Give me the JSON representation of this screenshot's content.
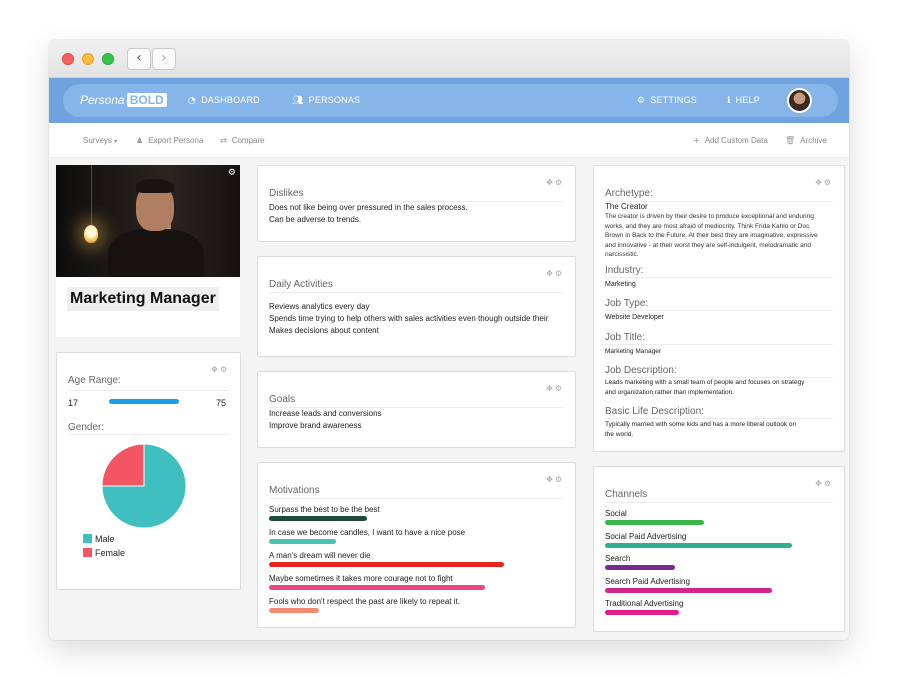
{
  "window": {
    "back_icon": "chevron-left-icon",
    "forward_icon": "chevron-right-icon"
  },
  "appbar": {
    "logo_text": "Persona",
    "logo_bold": "BOLD",
    "dashboard_label": "DASHBOARD",
    "personas_label": "PERSONAS",
    "settings_label": "SETTINGS",
    "help_label": "HELP"
  },
  "subbar": {
    "surveys_label": "Surveys",
    "export_label": "Export Persona",
    "compare_label": "Compare",
    "add_custom_label": "Add Custom Data",
    "archive_label": "Archive"
  },
  "profile": {
    "title": "Marketing Manager"
  },
  "demographics": {
    "age_title": "Age Range:",
    "age_min": "17",
    "age_max": "75",
    "gender_title": "Gender:",
    "gender": [
      {
        "label": "Male",
        "value": 75,
        "color": "#3fbfbf"
      },
      {
        "label": "Female",
        "value": 25,
        "color": "#f25563"
      }
    ]
  },
  "dislikes": {
    "title": "Dislikes",
    "lines": [
      "Does not like being over pressured in the sales process.",
      "Can be adverse to trends."
    ]
  },
  "daily": {
    "title": "Daily Activities",
    "lines": [
      "Reviews analytics every day",
      "Spends time trying to help others with sales activities even though outside their",
      "Makes decisions about content"
    ]
  },
  "goals": {
    "title": "Goals",
    "lines": [
      "Increase leads and conversions",
      "Improve brand awareness"
    ]
  },
  "motivations": {
    "title": "Motivations",
    "items": [
      {
        "label": "Surpass the best to be the best",
        "level": 0.41,
        "color": "#1e4a3a"
      },
      {
        "label": "In case we become candles, I want to have a nice pose",
        "level": 0.28,
        "color": "#4cc2b5"
      },
      {
        "label": "A man's dream will never die",
        "level": 0.98,
        "color": "#e8241f"
      },
      {
        "label": "Maybe sometimes it takes more courage not to fight",
        "level": 0.9,
        "color": "#e9477d"
      },
      {
        "label": "Fools who don't respect the past are likely to repeat it.",
        "level": 0.21,
        "color": "#f28b74"
      }
    ]
  },
  "archetype": {
    "title": "Archetype:",
    "name": "The Creator",
    "desc": "The creator is driven by their desire to produce exceptional and enduring works, and they are most afraid of mediocrity. Think Frida Kahlo or Doc Brown in Back to the Future. At their best they are imaginative, expressive and innovative - at their worst they are self-indulgent, melodramatic and narcissistic.",
    "industry_title": "Industry:",
    "industry": "Marketing",
    "jobtype_title": "Job Type:",
    "jobtype": "Website Developer",
    "jobtitle_title": "Job Title:",
    "jobtitle": "Marketing Manager",
    "jobdesc_title": "Job Description:",
    "jobdesc": "Leads marketing with a small team of people and focuses on strategy and organization rather than implementation.",
    "life_title": "Basic Life Description:",
    "life": "Typically married with some kids and has a more liberal outlook on the world."
  },
  "channels": {
    "title": "Channels",
    "items": [
      {
        "label": "Social",
        "level": 0.44,
        "color": "#3bb54a"
      },
      {
        "label": "Social Paid Advertising",
        "level": 0.83,
        "color": "#2fae90"
      },
      {
        "label": "Search",
        "level": 0.31,
        "color": "#7b2a8c"
      },
      {
        "label": "Search Paid Advertising",
        "level": 0.74,
        "color": "#d2268f"
      },
      {
        "label": "Traditional Advertising",
        "level": 0.33,
        "color": "#e01a8c"
      }
    ]
  }
}
